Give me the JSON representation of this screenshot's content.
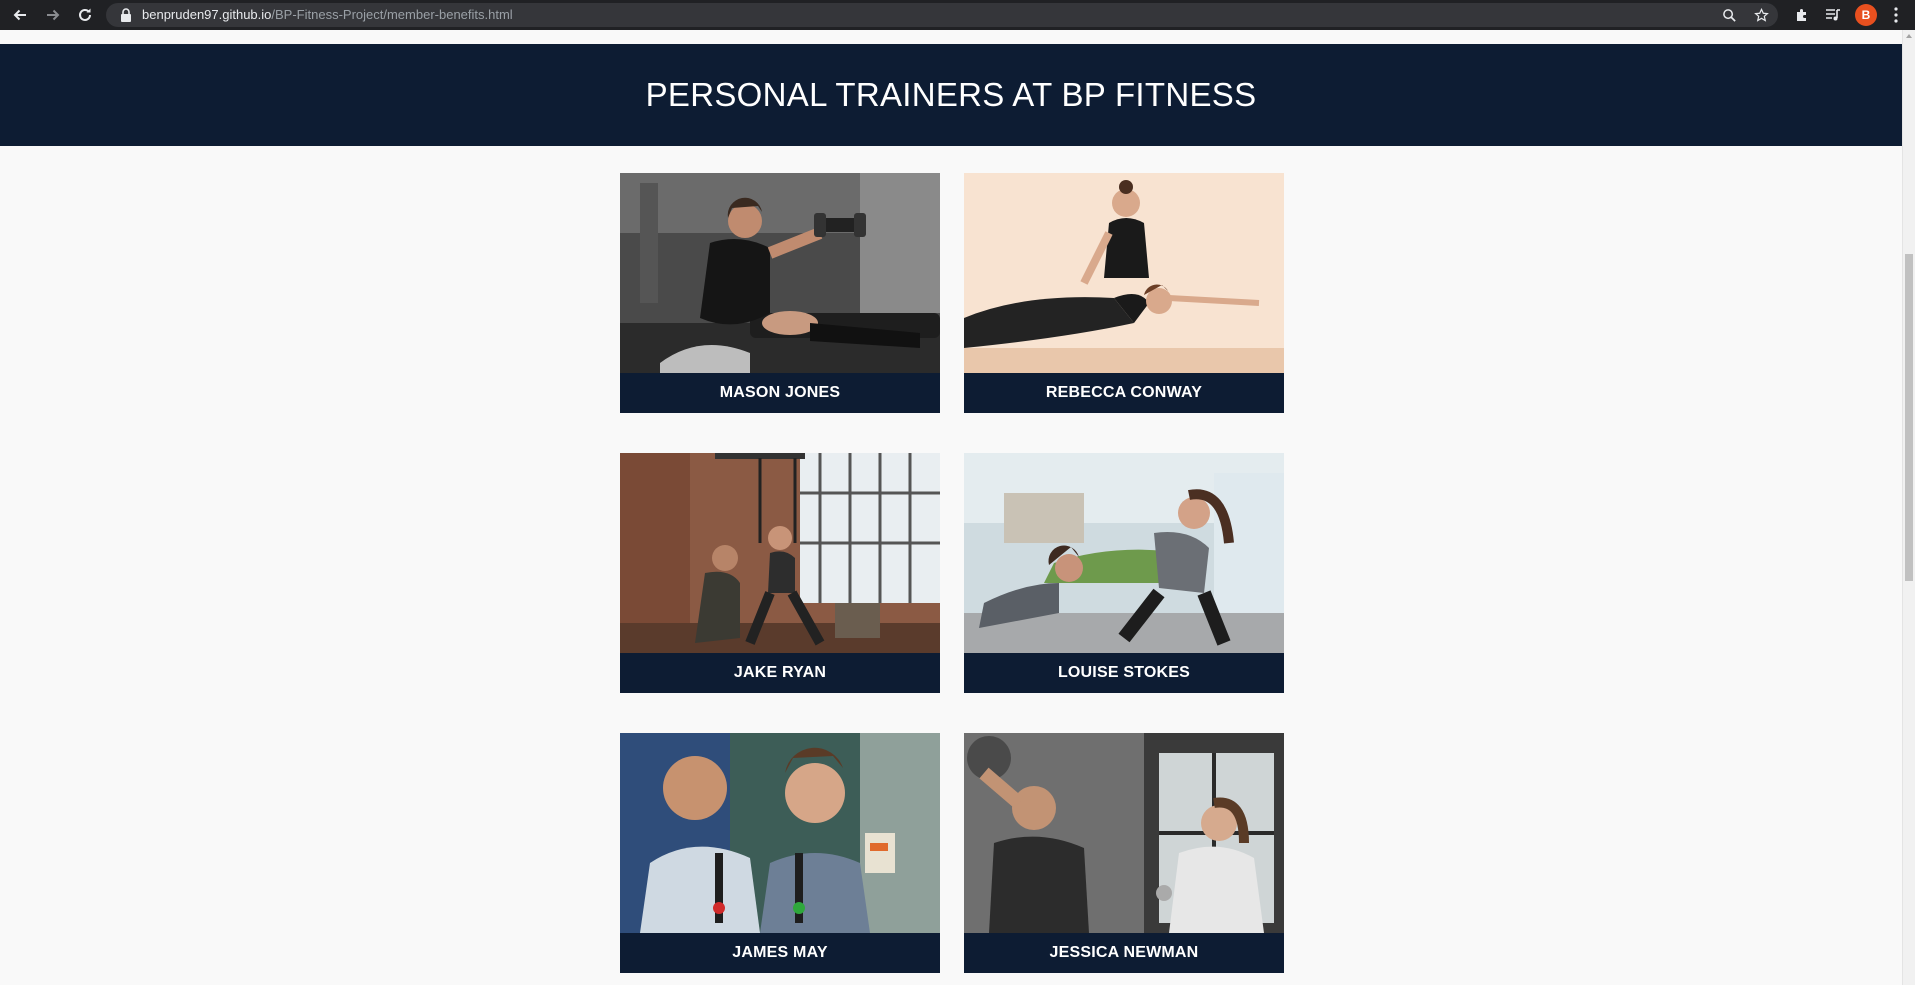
{
  "browser": {
    "url_host": "benpruden97.github.io",
    "url_path": "/BP-Fitness-Project/member-benefits.html",
    "profile_initial": "B",
    "icons": [
      "back-icon",
      "forward-icon",
      "reload-icon",
      "lock-icon",
      "zoom-icon",
      "bookmark-star-icon",
      "extensions-icon",
      "media-icon",
      "menu-icon"
    ]
  },
  "page": {
    "heading": "PERSONAL TRAINERS AT BP FITNESS"
  },
  "trainers": [
    {
      "name": "MASON JONES"
    },
    {
      "name": "REBECCA CONWAY"
    },
    {
      "name": "JAKE RYAN"
    },
    {
      "name": "LOUISE STOKES"
    },
    {
      "name": "JAMES MAY"
    },
    {
      "name": "JESSICA NEWMAN"
    }
  ],
  "colors": {
    "navy": "#0d1c33",
    "page_bg": "#f9f9f9",
    "chrome_bg": "#202124",
    "avatar": "#e8501f"
  }
}
